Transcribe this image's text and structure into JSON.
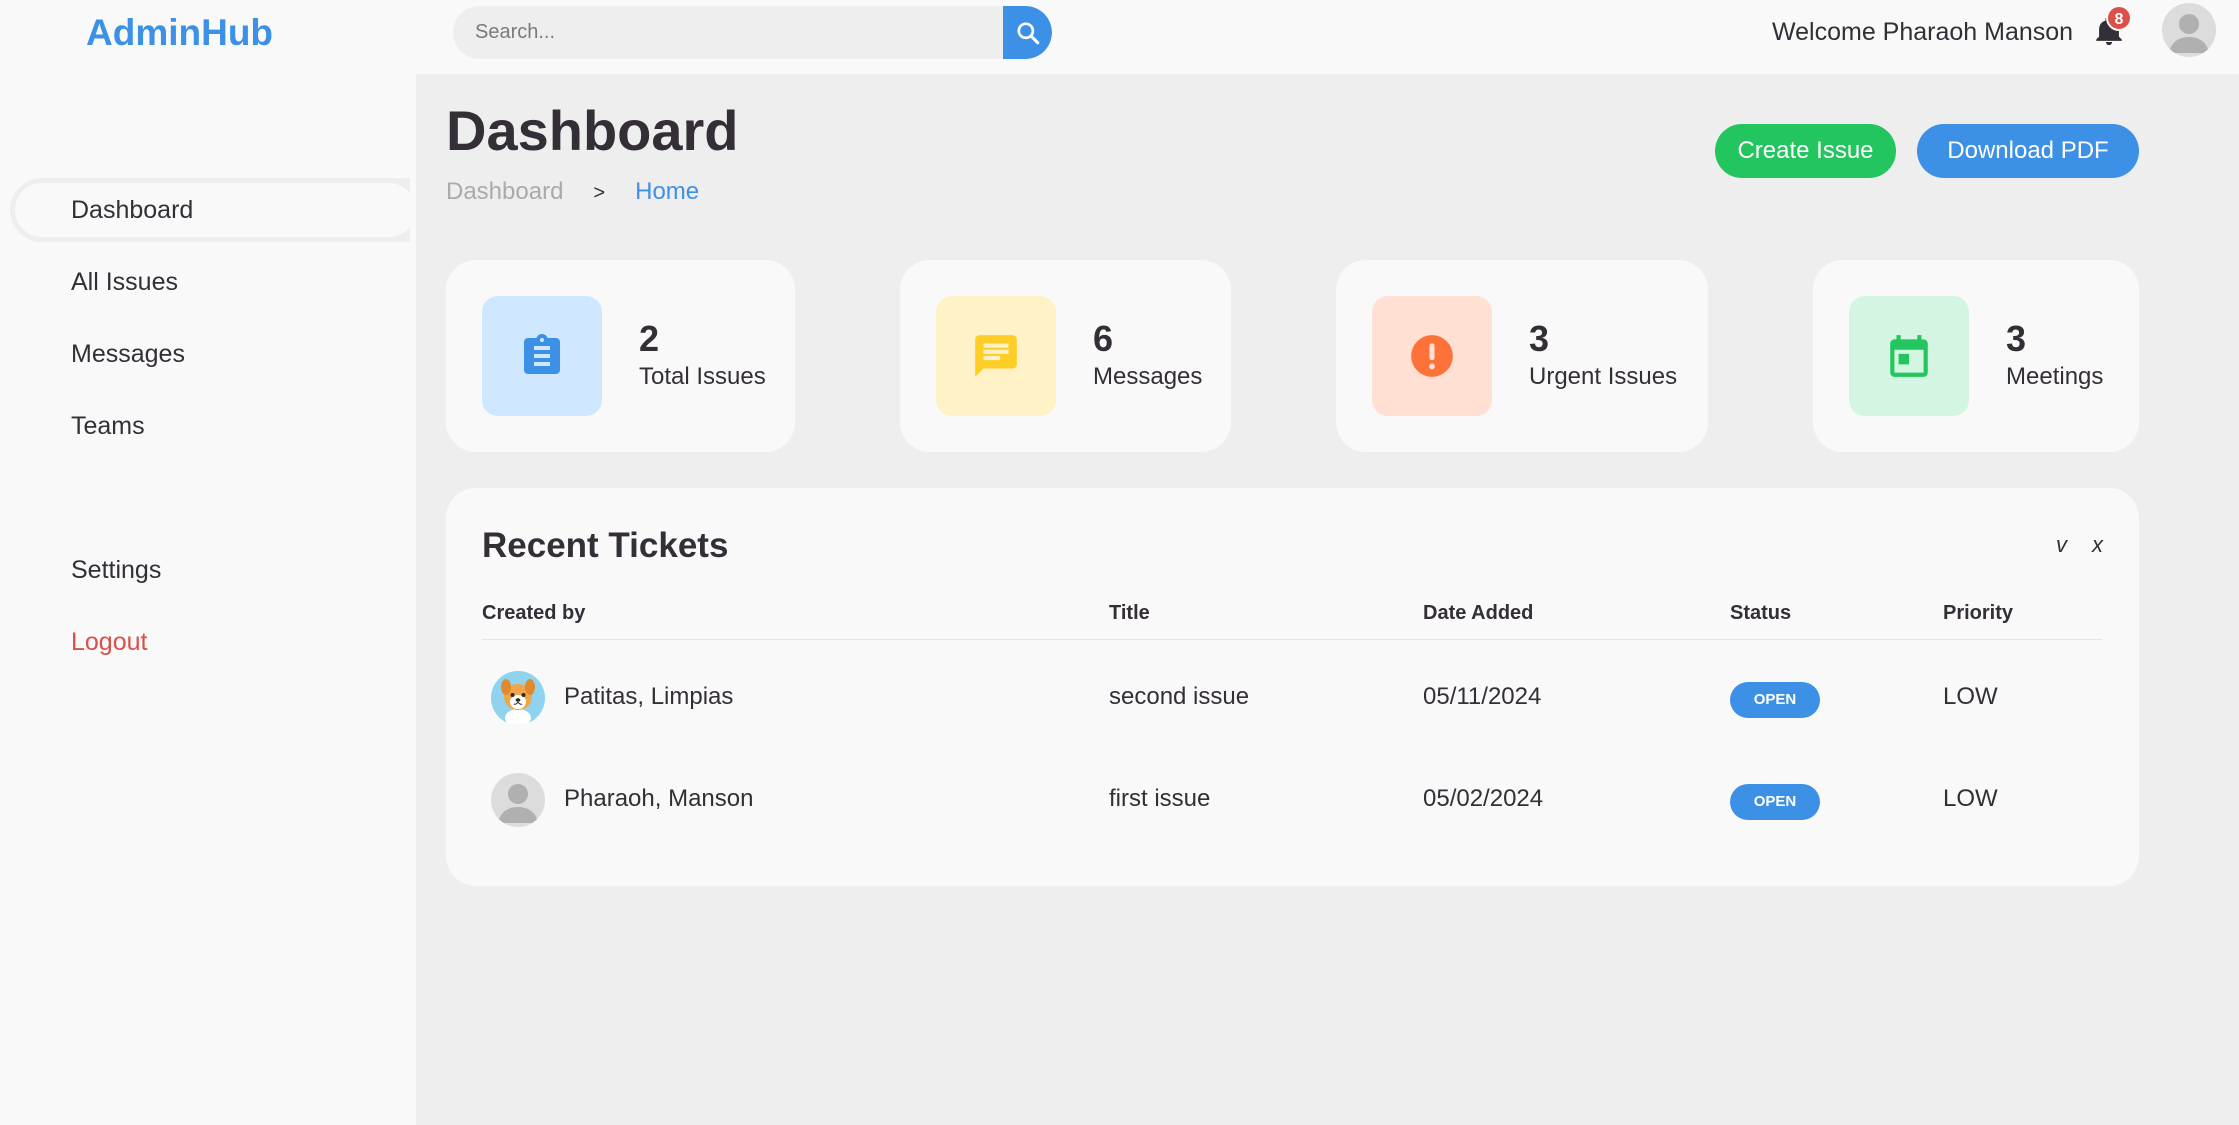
{
  "brand": "AdminHub",
  "search": {
    "placeholder": "Search..."
  },
  "header": {
    "welcome": "Welcome Pharaoh Manson",
    "notification_count": "8"
  },
  "sidebar": {
    "items": [
      {
        "label": "Dashboard"
      },
      {
        "label": "All Issues"
      },
      {
        "label": "Messages"
      },
      {
        "label": "Teams"
      },
      {
        "label": "Settings"
      },
      {
        "label": "Logout"
      }
    ]
  },
  "main": {
    "title": "Dashboard",
    "breadcrumb": [
      "Dashboard",
      ">",
      "Home"
    ],
    "buttons": {
      "create": "Create Issue",
      "download": "Download PDF"
    },
    "stats": [
      {
        "value": "2",
        "label": "Total Issues",
        "icon": "clipboard-icon",
        "color": "#3c91e6",
        "bg": "#cfe8ff"
      },
      {
        "value": "6",
        "label": "Messages",
        "icon": "message-icon",
        "color": "#ffce26",
        "bg": "#fff2c6"
      },
      {
        "value": "3",
        "label": "Urgent Issues",
        "icon": "alert-icon",
        "color": "#fd7238",
        "bg": "#ffe0d3"
      },
      {
        "value": "3",
        "label": "Meetings",
        "icon": "calendar-icon",
        "color": "#22c55e",
        "bg": "#d3f5e1"
      }
    ]
  },
  "tickets": {
    "title": "Recent Tickets",
    "controls": [
      "v",
      "x"
    ],
    "columns": [
      "Created by",
      "Title",
      "Date Added",
      "Status",
      "Priority"
    ],
    "rows": [
      {
        "created_by": "Patitas, Limpias",
        "title": "second issue",
        "date": "05/11/2024",
        "status": "OPEN",
        "priority": "LOW",
        "avatar": "dog-avatar"
      },
      {
        "created_by": "Pharaoh, Manson",
        "title": "first issue",
        "date": "05/02/2024",
        "status": "OPEN",
        "priority": "LOW",
        "avatar": "default-user-avatar"
      }
    ]
  },
  "colors": {
    "accent": "#3c91e6",
    "success": "#22c55e",
    "danger": "#db504a"
  }
}
